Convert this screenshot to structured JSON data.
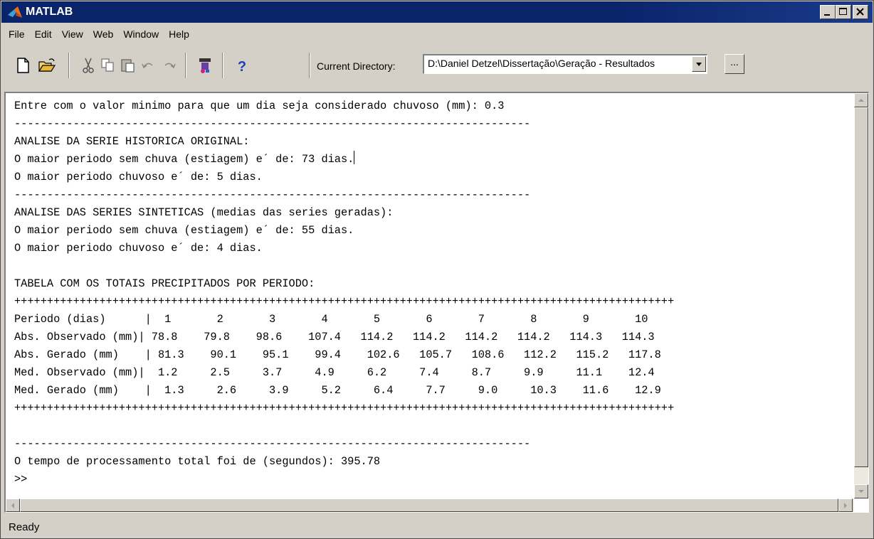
{
  "window": {
    "title": "MATLAB",
    "title_bar_color": "#0a246a",
    "icon": "matlab-logo-icon"
  },
  "menu": [
    "File",
    "Edit",
    "View",
    "Web",
    "Window",
    "Help"
  ],
  "toolbar": {
    "icons": [
      "new-file-icon",
      "open-folder-icon",
      "cut-icon",
      "copy-icon",
      "paste-icon",
      "undo-icon",
      "redo-icon",
      "simulink-icon",
      "help-icon"
    ],
    "help_label": "?",
    "current_directory_label": "Current Directory:",
    "current_directory_value": "D:\\Daniel Detzel\\Dissertação\\Geração - Resultados",
    "browse_label": "..."
  },
  "console": {
    "lines": [
      "Entre com o valor minimo para que um dia seja considerado chuvoso (mm): 0.3",
      "-------------------------------------------------------------------------------",
      "ANALISE DA SERIE HISTORICA ORIGINAL:",
      "O maior periodo sem chuva (estiagem) e´ de: 73 dias.",
      "O maior periodo chuvoso e´ de: 5 dias.",
      "-------------------------------------------------------------------------------",
      "ANALISE DAS SERIES SINTETICAS (medias das series geradas):",
      "O maior periodo sem chuva (estiagem) e´ de: 55 dias.",
      "O maior periodo chuvoso e´ de: 4 dias.",
      "",
      "TABELA COM OS TOTAIS PRECIPITADOS POR PERIODO:",
      "+++++++++++++++++++++++++++++++++++++++++++++++++++++++++++++++++++++++++++++++++++++++++++++++++++++",
      "Periodo (dias)      |  1       2       3       4       5       6       7       8       9       10",
      "Abs. Observado (mm)| 78.8    79.8    98.6    107.4   114.2   114.2   114.2   114.2   114.3   114.3",
      "Abs. Gerado (mm)    | 81.3    90.1    95.1    99.4    102.6   105.7   108.6   112.2   115.2   117.8",
      "Med. Observado (mm)|  1.2     2.5     3.7     4.9     6.2     7.4     8.7     9.9     11.1    12.4",
      "Med. Gerado (mm)    |  1.3     2.6     3.9     5.2     6.4     7.7     9.0     10.3    11.6    12.9",
      "+++++++++++++++++++++++++++++++++++++++++++++++++++++++++++++++++++++++++++++++++++++++++++++++++++++",
      "",
      "-------------------------------------------------------------------------------",
      "O tempo de processamento total foi de (segundos): 395.78",
      ">>"
    ]
  },
  "status": "Ready"
}
